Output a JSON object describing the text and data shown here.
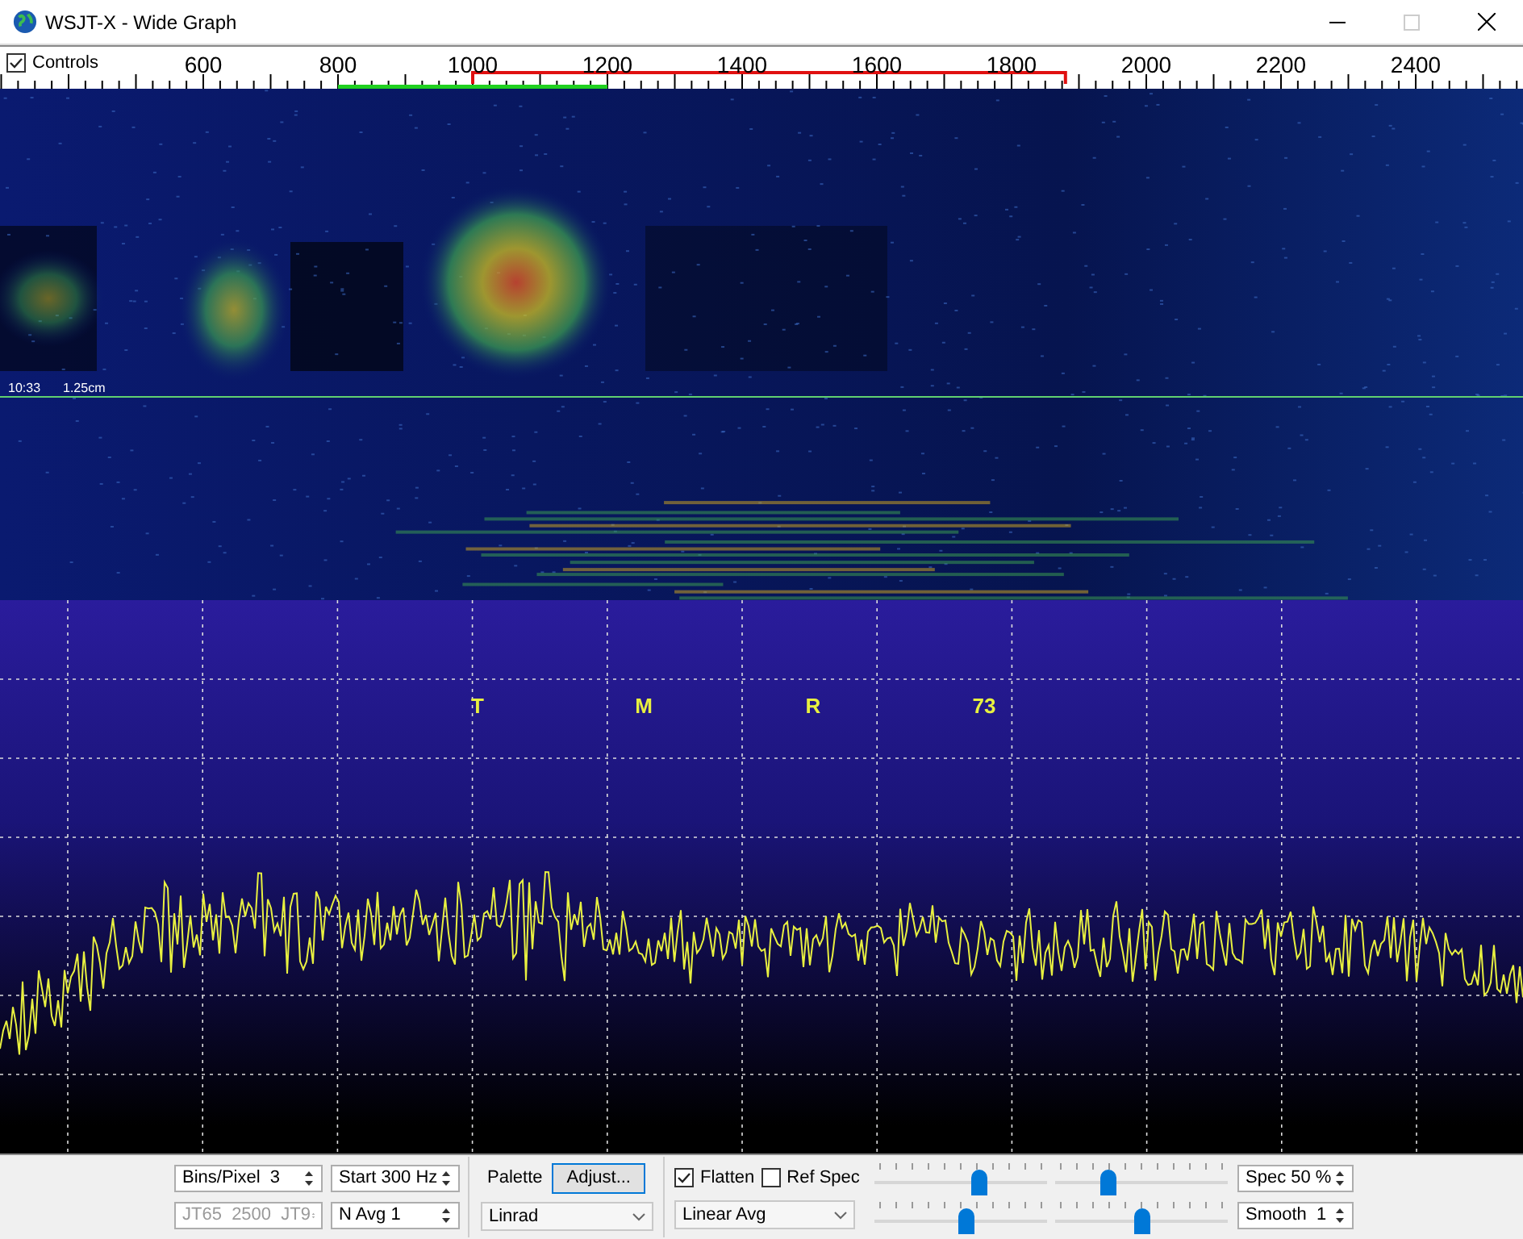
{
  "window": {
    "title": "WSJT-X - Wide Graph"
  },
  "controls_toggle": {
    "label": "Controls",
    "checked": true
  },
  "ruler": {
    "ticks": [
      "600",
      "800",
      "1000",
      "1200",
      "1400",
      "1600",
      "1800",
      "2000",
      "2200",
      "2400"
    ]
  },
  "waterfall": {
    "time": "10:33",
    "band": "1.25cm"
  },
  "spectrum": {
    "labels": [
      "T",
      "M",
      "R",
      "73"
    ]
  },
  "settings": {
    "bins_per_pixel": "Bins/Pixel  3",
    "start": "Start 300 Hz",
    "mode": {
      "text": "JT65  2500  JT9",
      "disabled": true
    },
    "n_avg": "N Avg 1",
    "palette_label": "Palette",
    "adjust_button": "Adjust...",
    "palette": "Linrad",
    "flatten": {
      "label": "Flatten",
      "checked": true
    },
    "ref_spec": {
      "label": "Ref Spec",
      "checked": false
    },
    "spectrum_type": "Linear Avg",
    "sliders": [
      {
        "level": 0.61
      },
      {
        "level": 0.31
      },
      {
        "level": 0.53
      },
      {
        "level": 0.5
      }
    ],
    "spec": "Spec 50 %",
    "smooth": "Smooth  1"
  }
}
